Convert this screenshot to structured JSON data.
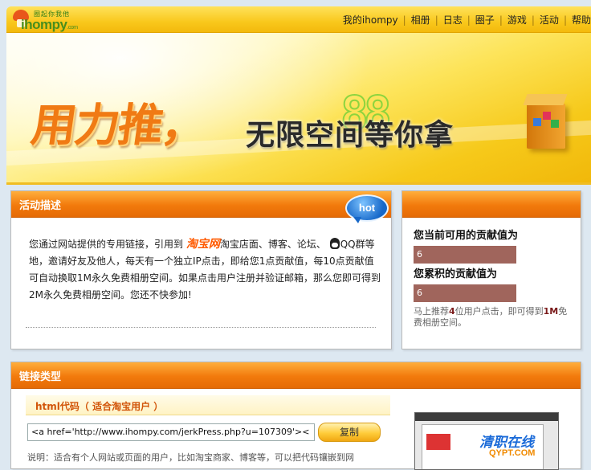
{
  "header": {
    "logo_tagline": "圈起你我他",
    "logo_text": "ihompy",
    "logo_domain": ".com",
    "nav": [
      "我的ihompy",
      "相册",
      "日志",
      "圈子",
      "游戏",
      "活动",
      "帮助"
    ]
  },
  "banner": {
    "headline": "用力推",
    "comma": "，",
    "subline": "无限空间等你拿",
    "digits": "88"
  },
  "activity": {
    "title": "活动描述",
    "hot_badge": "hot",
    "desc_part1": "您通过网站提供的专用链接，引用到",
    "taobao": "淘宝网",
    "desc_part2": "淘宝店面、博客、论坛、",
    "desc_part3": "QQ群等地，邀请好友及他人，每天有一个独立IP点击，即给您1点贡献值，每10点贡献值可自动换取1M永久免费相册空间。如果点击用户注册并验证邮箱，那么您即可得到2M永久免费相册空间。您还不快参加!"
  },
  "contribution": {
    "current_label": "您当前可用的贡献值为",
    "current_value": "6",
    "total_label": "您累积的贡献值为",
    "total_value": "6",
    "note_part1": "马上推荐",
    "note_num": "4",
    "note_part2": "位用户点击，即可得到",
    "note_size": "1M",
    "note_part3": "免费相册空间。"
  },
  "link_types": {
    "title": "链接类型",
    "html_code_label": "html代码（ 适合淘宝用户 ）",
    "code_value": "<a href='http://www.ihompy.com/jerkPress.php?u=107309'><",
    "copy_button": "复制",
    "explain": "说明：适合有个人网站或页面的用户，比如淘宝商家、博客等，可以把代码镶嵌到网",
    "watermark_cn": "清职在线",
    "watermark_en": "QYPT.COM"
  }
}
